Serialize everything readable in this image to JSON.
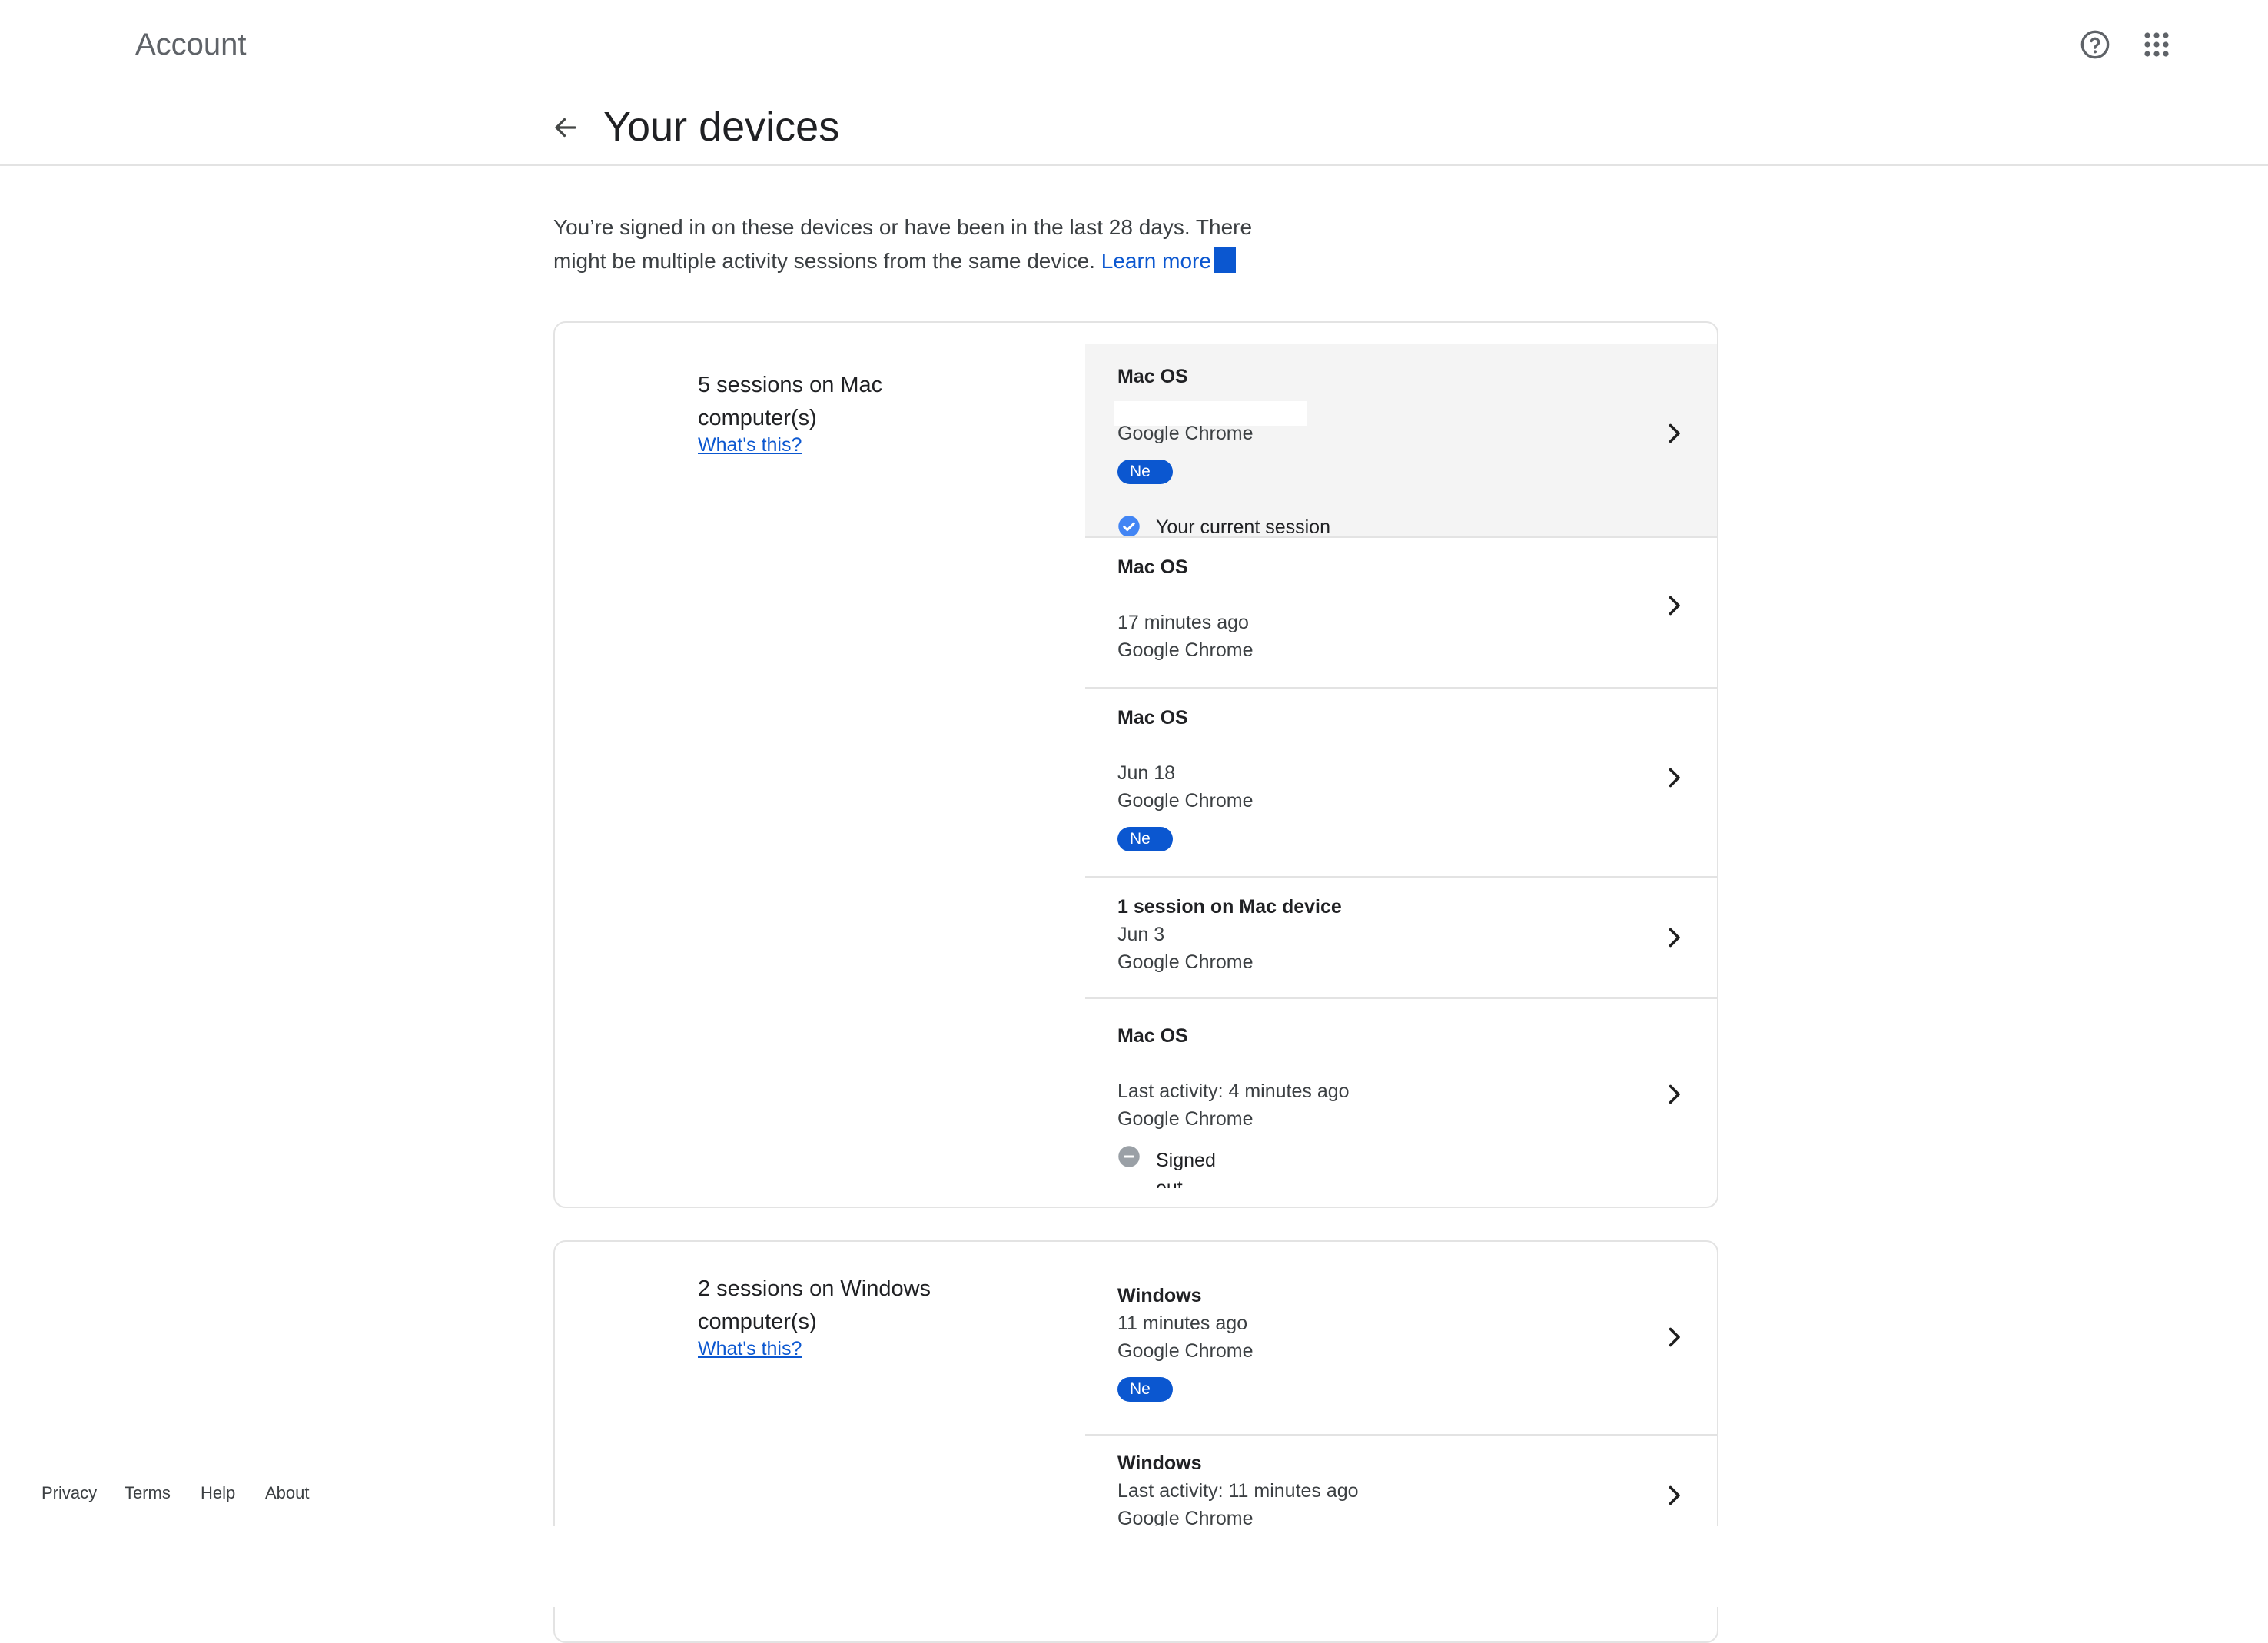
{
  "header": {
    "app_title": "Account",
    "help_icon": "help-circle-icon",
    "apps_icon": "apps-grid-icon"
  },
  "page": {
    "title": "Your devices",
    "back_icon": "arrow-back-icon",
    "intro": "You’re signed in on these devices or have been in the last 28 days. There might be multiple activity sessions from the same device.",
    "learn_more": "Learn more"
  },
  "groups": [
    {
      "title": "5 sessions on Mac computer(s)",
      "whats_this": "What's this?",
      "sessions": [
        {
          "name": "Mac OS",
          "line1": "",
          "line2": "Google Chrome",
          "badge": "Ne",
          "status": "Your current session"
        },
        {
          "name": "Mac OS",
          "line1": "17 minutes ago",
          "line2": "Google Chrome"
        },
        {
          "name": "Mac OS",
          "line1": "Jun 18",
          "line2": "Google Chrome",
          "badge": "Ne"
        },
        {
          "name": "1 session on Mac device",
          "line1": "Jun 3",
          "line2": "Google Chrome"
        },
        {
          "name": "Mac OS",
          "line1": "Last activity: 4 minutes ago",
          "line2": "Google Chrome",
          "status": "Signed out"
        }
      ]
    },
    {
      "title": "2 sessions on Windows computer(s)",
      "whats_this": "What's this?",
      "sessions": [
        {
          "name": "Windows",
          "line1": "11 minutes ago",
          "line2": "Google Chrome",
          "badge": "Ne"
        },
        {
          "name": "Windows",
          "line1": "Last activity: 11 minutes ago",
          "line2": "Google Chrome"
        }
      ]
    }
  ],
  "footer": {
    "privacy": "Privacy",
    "terms": "Terms",
    "help": "Help",
    "about": "About"
  },
  "colors": {
    "accent": "#0b57d0",
    "selected_row": "#f4f4f4",
    "divider": "#e3e3e3"
  }
}
